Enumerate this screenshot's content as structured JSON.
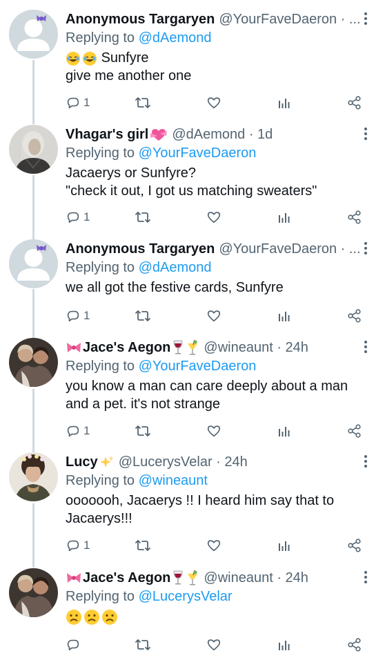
{
  "tweets": [
    {
      "name": "Anonymous Targaryen",
      "handle": "@YourFaveDaeron · ...",
      "replying_prefix": "Replying to ",
      "replying_to": "@dAemond",
      "text_lines": [
        "Sunfyre",
        "give me another one"
      ],
      "reply_count": "1",
      "avatar": "default-avatar-with-bow"
    },
    {
      "name": "Vhagar's girl",
      "handle": "@dAemond · 1d",
      "replying_prefix": "Replying to ",
      "replying_to": "@YourFaveDaeron",
      "text_lines": [
        "Jacaerys or Sunfyre?",
        "\"check it out, I got us matching sweaters\""
      ],
      "reply_count": "1",
      "avatar": "photo-silver-haired-man"
    },
    {
      "name": "Anonymous Targaryen",
      "handle": "@YourFaveDaeron · ...",
      "replying_prefix": "Replying to ",
      "replying_to": "@dAemond",
      "text_lines": [
        "we all got the festive cards, Sunfyre"
      ],
      "reply_count": "1",
      "avatar": "default-avatar-with-bow"
    },
    {
      "name": "Jace's Aegon",
      "handle": "@wineaunt · 24h",
      "replying_prefix": "Replying to ",
      "replying_to": "@YourFaveDaeron",
      "text_lines": [
        "you know a man can care deeply about a man",
        "and a pet. it's not strange"
      ],
      "reply_count": "1",
      "avatar": "photo-two-people"
    },
    {
      "name": "Lucy",
      "handle": "@LucerysVelar · 24h",
      "replying_prefix": "Replying to ",
      "replying_to": "@wineaunt",
      "text_lines": [
        "ooooooh, Jacaerys !! I heard him say that to",
        "Jacaerys!!!"
      ],
      "reply_count": "1",
      "avatar": "photo-curly-haired-boy-flower-crown"
    },
    {
      "name": "Jace's Aegon",
      "handle": "@wineaunt · 24h",
      "replying_prefix": "Replying to ",
      "replying_to": "@LucerysVelar",
      "text_lines": [
        ""
      ],
      "reply_count": "",
      "avatar": "photo-two-people"
    }
  ],
  "colors": {
    "text": "#0f1419",
    "muted": "#536471",
    "link": "#1d9bf0",
    "thread_line": "#cfd9de"
  },
  "icons": [
    "reply-icon",
    "retweet-icon",
    "like-icon",
    "analytics-icon",
    "share-icon",
    "more-icon"
  ]
}
